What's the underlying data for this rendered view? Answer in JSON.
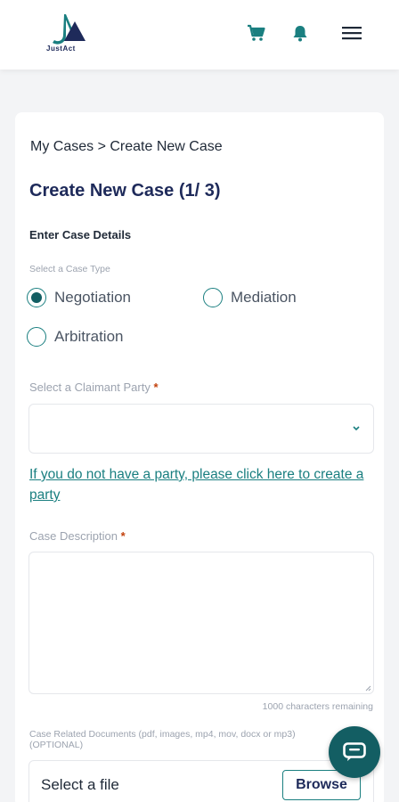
{
  "header": {
    "logo_text": "JustAct",
    "logo_icon": "justact-logo",
    "cart_icon": "cart-icon",
    "bell_icon": "bell-icon",
    "menu_icon": "hamburger-menu-icon",
    "brand_color": "#1a7f80",
    "navy_color": "#1e2a5a"
  },
  "breadcrumb": "My Cases > Create New Case",
  "title": "Create New Case (1/ 3)",
  "section_title": "Enter Case Details",
  "case_type": {
    "label": "Select a Case Type",
    "options": [
      {
        "label": "Negotiation",
        "selected": true
      },
      {
        "label": "Mediation",
        "selected": false
      },
      {
        "label": "Arbitration",
        "selected": false
      }
    ]
  },
  "claimant": {
    "label": "Select a Claimant Party",
    "required_mark": "*",
    "value": ""
  },
  "create_party_link": "If you do not have a party, please click here to create a party",
  "description": {
    "label": "Case Description",
    "required_mark": "*",
    "value": "",
    "remaining": "1000 characters remaining"
  },
  "documents": {
    "label": "Case Related Documents (pdf, images, mp4, mov, docx or mp3) (OPTIONAL)",
    "placeholder": "Select a file",
    "browse_label": "Browse"
  },
  "chat_icon": "chat-icon"
}
